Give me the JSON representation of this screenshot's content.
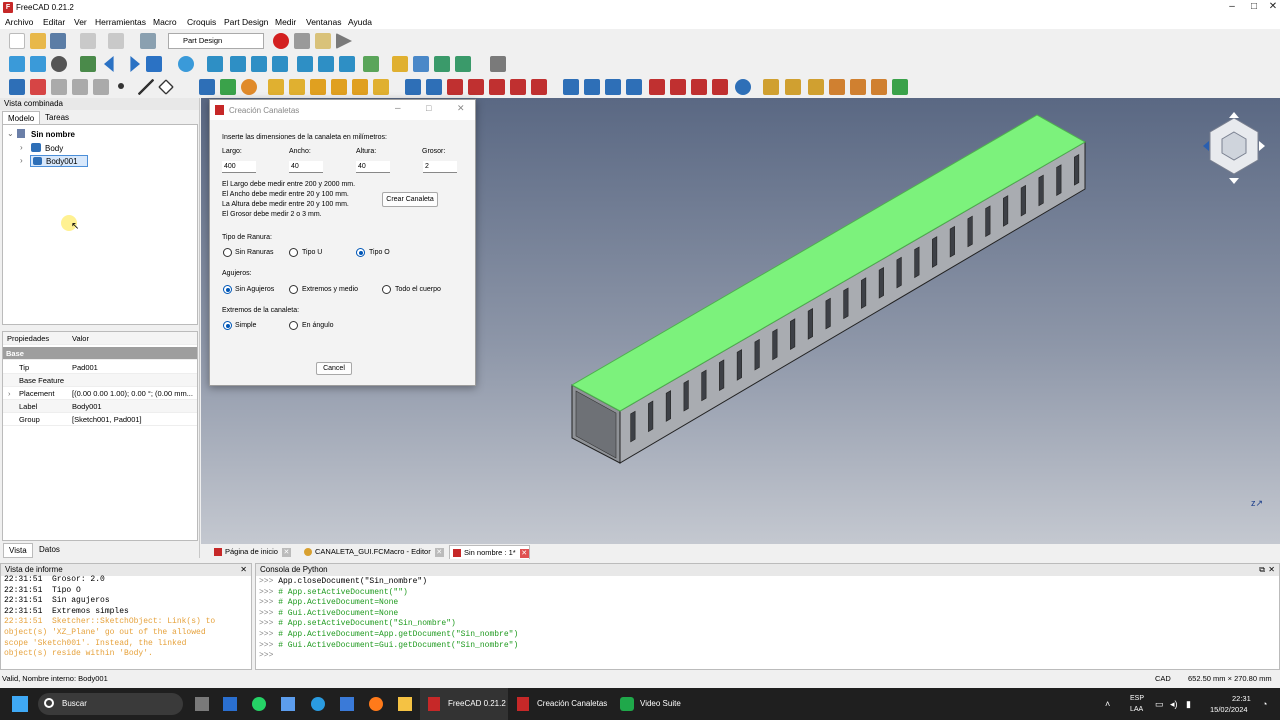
{
  "app": {
    "title": "FreeCAD 0.21.2"
  },
  "menu": [
    "Archivo",
    "Editar",
    "Ver",
    "Herramientas",
    "Macro",
    "Croquis",
    "Part Design",
    "Medir",
    "Ventanas",
    "Ayuda"
  ],
  "workbench": "Part Design",
  "left_panel": {
    "title": "Vista combinada",
    "tabs": [
      "Modelo",
      "Tareas"
    ],
    "tree": {
      "root": "Sin nombre",
      "items": [
        "Body",
        "Body001"
      ]
    },
    "props_header": {
      "k": "Propiedades",
      "v": "Valor"
    },
    "group": "Base",
    "props": [
      {
        "k": "Tip",
        "v": "Pad001"
      },
      {
        "k": "Base Feature",
        "v": ""
      },
      {
        "k": "Placement",
        "v": "[(0.00 0.00 1.00); 0.00 °; (0.00 mm..."
      },
      {
        "k": "Label",
        "v": "Body001"
      },
      {
        "k": "Group",
        "v": "[Sketch001, Pad001]"
      }
    ],
    "bottom_tabs": [
      "Vista",
      "Datos"
    ]
  },
  "dialog": {
    "title": "Creación Canaletas",
    "intro": "Inserte las dimensiones de la canaleta en milímetros:",
    "fields": [
      {
        "label": "Largo:",
        "value": "400"
      },
      {
        "label": "Ancho:",
        "value": "40"
      },
      {
        "label": "Altura:",
        "value": "40"
      },
      {
        "label": "Grosor:",
        "value": "2"
      }
    ],
    "rules": [
      "El Largo debe medir entre 200 y 2000 mm.",
      "El Ancho debe medir entre 20 y 100 mm.",
      "La Altura debe medir entre 20 y 100 mm.",
      "El Grosor debe medir 2 o 3 mm."
    ],
    "create_button": "Crear Canaleta",
    "ranura_title": "Tipo de Ranura:",
    "ranura_opts": [
      "Sin Ranuras",
      "Tipo U",
      "Tipo O"
    ],
    "ranura_selected": 2,
    "agujeros_title": "Agujeros:",
    "agujeros_opts": [
      "Sin Agujeros",
      "Extremos y medio",
      "Todo el cuerpo"
    ],
    "agujeros_selected": 0,
    "extremos_title": "Extremos de la canaleta:",
    "extremos_opts": [
      "Simple",
      "En ángulo"
    ],
    "extremos_selected": 0,
    "cancel_button": "Cancel"
  },
  "doc_tabs": [
    "Página de inicio",
    "CANALETA_GUI.FCMacro - Editor",
    "Sin nombre : 1*"
  ],
  "report": {
    "title": "Vista de informe",
    "lines": [
      {
        "text": "22:31:51  Grosor: 2.0",
        "color": "#000000"
      },
      {
        "text": "22:31:51  Tipo O",
        "color": "#000000"
      },
      {
        "text": "22:31:51  Sin agujeros",
        "color": "#000000"
      },
      {
        "text": "22:31:51  Extremos simples",
        "color": "#000000"
      },
      {
        "text": "22:31:51  Sketcher::SketchObject: Link(s) to",
        "color": "#e6a23c"
      },
      {
        "text": "object(s) 'XZ_Plane' go out of the allowed",
        "color": "#e6a23c"
      },
      {
        "text": "scope 'Sketch001'. Instead, the linked",
        "color": "#e6a23c"
      },
      {
        "text": "object(s) reside within 'Body'.",
        "color": "#e6a23c"
      }
    ]
  },
  "python": {
    "title": "Consola de Python",
    "lines": [
      {
        "p": ">>> ",
        "code": "App.closeDocument(\"Sin_nombre\")",
        "kind": "code"
      },
      {
        "p": ">>> ",
        "code": "# App.setActiveDocument(\"\")",
        "kind": "comment"
      },
      {
        "p": ">>> ",
        "code": "# App.ActiveDocument=None",
        "kind": "comment"
      },
      {
        "p": ">>> ",
        "code": "# Gui.ActiveDocument=None",
        "kind": "comment"
      },
      {
        "p": ">>> ",
        "code": "# App.setActiveDocument(\"Sin_nombre\")",
        "kind": "comment"
      },
      {
        "p": ">>> ",
        "code": "# App.ActiveDocument=App.getDocument(\"Sin_nombre\")",
        "kind": "comment"
      },
      {
        "p": ">>> ",
        "code": "# Gui.ActiveDocument=Gui.getDocument(\"Sin_nombre\")",
        "kind": "comment"
      },
      {
        "p": ">>> ",
        "code": "",
        "kind": "code"
      }
    ]
  },
  "status": {
    "left": "Valid, Nombre interno: Body001",
    "nav": "CAD",
    "dims": "652.50 mm × 270.80 mm"
  },
  "taskbar": {
    "search": "Buscar",
    "apps": [
      "FreeCAD 0.21.2",
      "Creación Canaletas",
      "Video Suite"
    ],
    "lang1": "ESP",
    "lang2": "LAA",
    "time": "22:31",
    "date": "15/02/2024"
  },
  "colors": {
    "accent": "#0057b7",
    "highlight": "#7cf27c",
    "view_top": "#5a6883",
    "view_bottom": "#c4c8d0"
  }
}
